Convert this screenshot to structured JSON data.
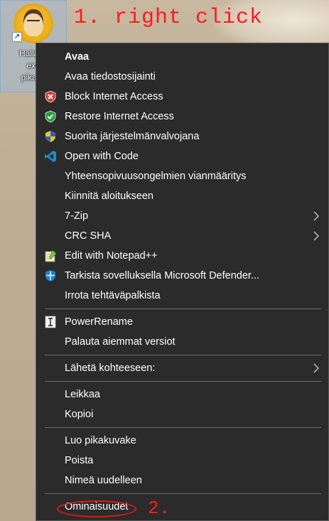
{
  "desktop": {
    "icon_label": "Hallaco\nexe\npikaku",
    "shortcut_icon": "shortcut-arrow-icon",
    "accent_selection_color": "#9ebad6"
  },
  "annotations": {
    "step1": "1. right click",
    "step2": "2.",
    "color": "#ff1a1a"
  },
  "menu": {
    "background": "#2b2b2b",
    "items": [
      {
        "label": "Avaa",
        "bold": true
      },
      {
        "label": "Avaa tiedostosijainti"
      },
      {
        "label": "Block Internet Access",
        "icon": "shield-red-x-icon"
      },
      {
        "label": "Restore Internet Access",
        "icon": "shield-green-check-icon"
      },
      {
        "label": "Suorita järjestelmänvalvojana",
        "icon": "uac-shield-icon"
      },
      {
        "label": "Open with Code",
        "icon": "vscode-icon"
      },
      {
        "label": "Yhteensopivuusongelmien vianmääritys"
      },
      {
        "label": "Kiinnitä aloitukseen"
      },
      {
        "label": "7-Zip",
        "submenu": true
      },
      {
        "label": "CRC SHA",
        "submenu": true
      },
      {
        "label": "Edit with Notepad++",
        "icon": "notepadpp-icon"
      },
      {
        "label": "Tarkista sovelluksella Microsoft Defender...",
        "icon": "defender-icon"
      },
      {
        "label": "Irrota tehtäväpalkista"
      },
      {
        "label": "PowerRename",
        "icon": "powerrename-icon"
      },
      {
        "label": "Palauta aiemmat versiot"
      },
      {
        "label": "Lähetä kohteeseen:",
        "submenu": true
      },
      {
        "label": "Leikkaa"
      },
      {
        "label": "Kopioi"
      },
      {
        "label": "Luo pikakuvake"
      },
      {
        "label": "Poista"
      },
      {
        "label": "Nimeä uudelleen"
      },
      {
        "label": "Ominaisuudet"
      }
    ]
  }
}
